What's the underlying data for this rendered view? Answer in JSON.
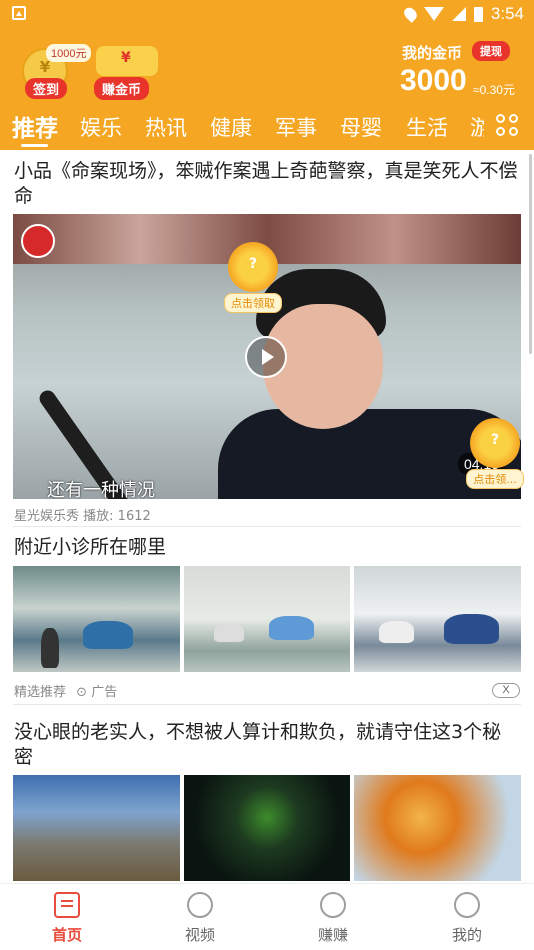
{
  "status_bar": {
    "time": "3:54",
    "icons": [
      "location-icon",
      "wifi-icon",
      "signal-icon",
      "battery-icon"
    ]
  },
  "header": {
    "signin": {
      "amount_badge": "1000元",
      "label": "签到"
    },
    "earn": {
      "label": "赚金币"
    },
    "my_coins": {
      "label": "我的金币",
      "withdraw_label": "提现",
      "value": "3000",
      "rmb": "≈0.30元"
    }
  },
  "tabs": [
    {
      "label": "推荐",
      "active": true
    },
    {
      "label": "娱乐"
    },
    {
      "label": "热讯"
    },
    {
      "label": "健康"
    },
    {
      "label": "军事"
    },
    {
      "label": "母婴"
    },
    {
      "label": "生活"
    },
    {
      "label": "游"
    }
  ],
  "feed": [
    {
      "type": "video",
      "title": "小品《命案现场》，笨贼作案遇上奇葩警察，真是笑死人不偿命",
      "subtitle": "还有一种情况",
      "duration": "04:15",
      "source": "星光娱乐秀",
      "plays": "播放: 1612",
      "rewards": [
        {
          "mark": "?",
          "label": "点击领取"
        },
        {
          "mark": "?",
          "label": "点击领..."
        }
      ]
    },
    {
      "type": "ad",
      "title": "附近小诊所在哪里",
      "source": "精选推荐",
      "ad_tag": "广告",
      "close": "X"
    },
    {
      "type": "article",
      "title": "没心眼的老实人，不想被人算计和欺负，就请守住这3个秘密"
    }
  ],
  "bottom_nav": [
    {
      "label": "首页",
      "active": true,
      "icon": "home-icon"
    },
    {
      "label": "视频",
      "icon": "video-icon"
    },
    {
      "label": "赚赚",
      "icon": "earn-icon"
    },
    {
      "label": "我的",
      "icon": "profile-icon"
    }
  ],
  "colors": {
    "brand": "#f5a623",
    "accent": "#e8342a",
    "active_nav": "#e74c3c"
  }
}
